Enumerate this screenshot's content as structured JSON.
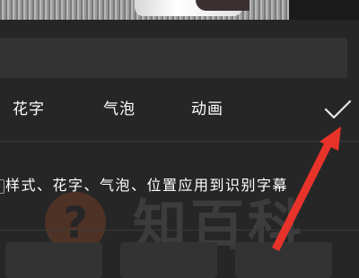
{
  "tabs": [
    {
      "label": "花字"
    },
    {
      "label": "气泡"
    },
    {
      "label": "动画"
    }
  ],
  "confirm_icon": "checkmark-icon",
  "apply_option": {
    "label": "样式、花字、气泡、位置应用到识别字幕"
  },
  "watermark": {
    "text": "知百科",
    "icon": "question-icon",
    "color": "#e0602a"
  },
  "annotation": {
    "arrow_color": "#e8332a"
  },
  "colors": {
    "background": "#262626",
    "field": "#333333",
    "text": "#ffffff"
  }
}
